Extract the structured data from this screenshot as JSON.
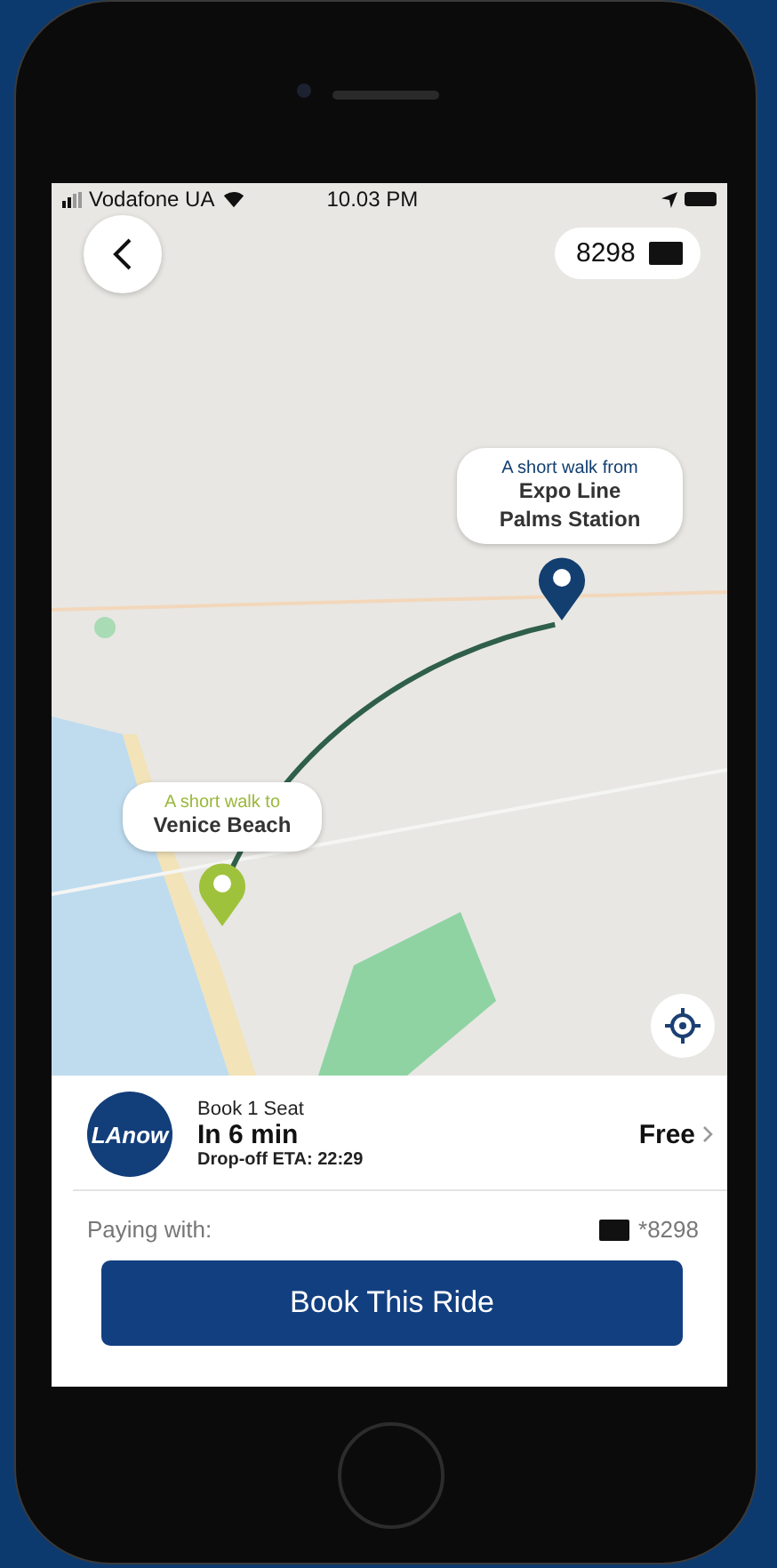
{
  "status_bar": {
    "carrier": "Vodafone UA",
    "time": "10.03 PM"
  },
  "map": {
    "payment_badge": "8298",
    "callouts": [
      {
        "kind": "dropoff",
        "caption": "A short walk from",
        "place": "Expo Line Palms Station"
      },
      {
        "kind": "pickup",
        "caption": "A short walk to",
        "place": "Venice Beach"
      }
    ]
  },
  "ride": {
    "logo_text": "LAnow",
    "title": "Book 1 Seat",
    "eta": "In 6 min",
    "dropoff": "Drop-off ETA: 22:29",
    "price": "Free"
  },
  "payment": {
    "label": "Paying with:",
    "card": "*8298"
  },
  "button": "Book This Ride"
}
